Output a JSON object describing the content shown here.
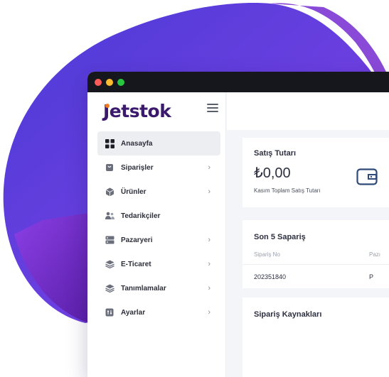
{
  "app": {
    "brand": "Jetstok",
    "brand_color": "#3b1a6e",
    "accent_color": "#f47a20"
  },
  "sidebar": {
    "items": [
      {
        "label": "Anasayfa",
        "icon": "grid-icon",
        "active": true,
        "has_chevron": false
      },
      {
        "label": "Siparişler",
        "icon": "shopping-bag-icon",
        "active": false,
        "has_chevron": true
      },
      {
        "label": "Ürünler",
        "icon": "box-icon",
        "active": false,
        "has_chevron": true
      },
      {
        "label": "Tedarikçiler",
        "icon": "users-icon",
        "active": false,
        "has_chevron": false
      },
      {
        "label": "Pazaryeri",
        "icon": "server-icon",
        "active": false,
        "has_chevron": true
      },
      {
        "label": "E-Ticaret",
        "icon": "layers-icon",
        "active": false,
        "has_chevron": true
      },
      {
        "label": "Tanımlamalar",
        "icon": "layers-icon",
        "active": false,
        "has_chevron": true
      },
      {
        "label": "Ayarlar",
        "icon": "sliders-icon",
        "active": false,
        "has_chevron": true
      }
    ]
  },
  "sales_card": {
    "title": "Satış Tutarı",
    "amount": "₺0,00",
    "subtitle": "Kasım Toplam Satış Tutarı",
    "icon": "wallet-icon"
  },
  "orders_card": {
    "title": "Son 5 Sapariş",
    "columns": [
      "Sipariş No",
      "Pazı"
    ],
    "rows": [
      {
        "order_no": "202351840",
        "market": "P"
      }
    ]
  },
  "sources_card": {
    "title": "Sipariş Kaynakları"
  }
}
